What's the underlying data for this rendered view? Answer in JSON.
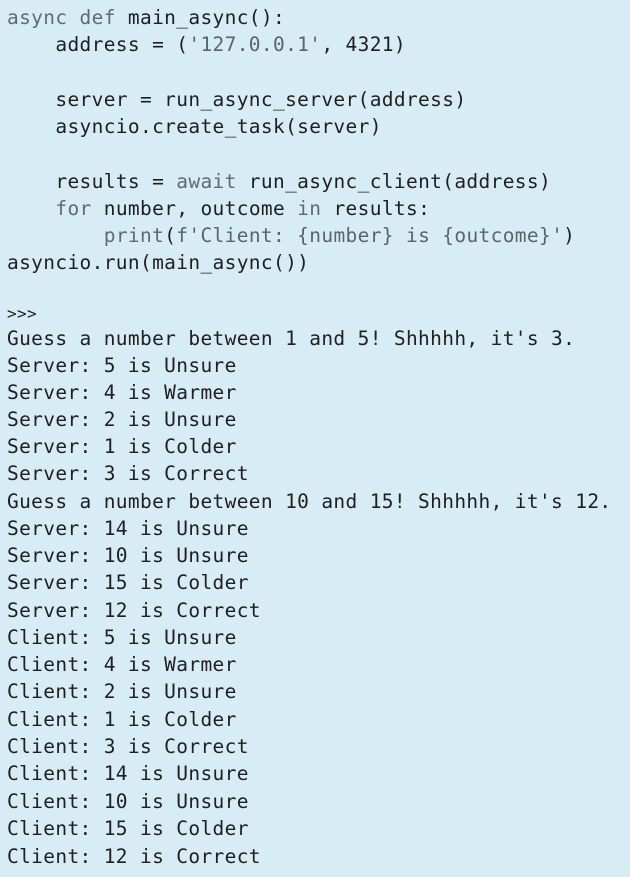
{
  "colors": {
    "background": "#d8ecf6",
    "text": "#1f1f1f",
    "keyword": "#5f6b74",
    "string": "#59646c"
  },
  "code": {
    "lines": [
      [
        {
          "t": "async def",
          "c": "kw"
        },
        {
          "t": " main_async():",
          "c": ""
        }
      ],
      [
        {
          "t": "    address = (",
          "c": ""
        },
        {
          "t": "'127.0.0.1'",
          "c": "str"
        },
        {
          "t": ", 4321)",
          "c": ""
        }
      ],
      [],
      [
        {
          "t": "    server = run_async_server(address)",
          "c": ""
        }
      ],
      [
        {
          "t": "    asyncio.create_task(server)",
          "c": ""
        }
      ],
      [],
      [
        {
          "t": "    results = ",
          "c": ""
        },
        {
          "t": "await",
          "c": "kw"
        },
        {
          "t": " run_async_client(address)",
          "c": ""
        }
      ],
      [
        {
          "t": "    ",
          "c": ""
        },
        {
          "t": "for",
          "c": "kw"
        },
        {
          "t": " number, outcome ",
          "c": ""
        },
        {
          "t": "in",
          "c": "kw"
        },
        {
          "t": " results:",
          "c": ""
        }
      ],
      [
        {
          "t": "        ",
          "c": ""
        },
        {
          "t": "print",
          "c": "kw"
        },
        {
          "t": "(",
          "c": ""
        },
        {
          "t": "f'Client: {number} is {outcome}'",
          "c": "str"
        },
        {
          "t": ")",
          "c": ""
        }
      ],
      [
        {
          "t": "asyncio.run(main_async())",
          "c": ""
        }
      ]
    ]
  },
  "output": {
    "prompt": ">>>",
    "lines": [
      "Guess a number between 1 and 5! Shhhhh, it's 3.",
      "Server: 5 is Unsure",
      "Server: 4 is Warmer",
      "Server: 2 is Unsure",
      "Server: 1 is Colder",
      "Server: 3 is Correct",
      "Guess a number between 10 and 15! Shhhhh, it's 12.",
      "Server: 14 is Unsure",
      "Server: 10 is Unsure",
      "Server: 15 is Colder",
      "Server: 12 is Correct",
      "Client: 5 is Unsure",
      "Client: 4 is Warmer",
      "Client: 2 is Unsure",
      "Client: 1 is Colder",
      "Client: 3 is Correct",
      "Client: 14 is Unsure",
      "Client: 10 is Unsure",
      "Client: 15 is Colder",
      "Client: 12 is Correct"
    ]
  }
}
